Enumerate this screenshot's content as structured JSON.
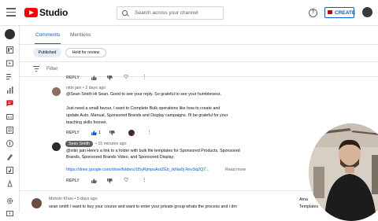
{
  "topbar": {
    "app_name": "Studio",
    "search_placeholder": "Search across your channel",
    "help_glyph": "?",
    "create_label": "CREATE"
  },
  "sidebar": {
    "icons": [
      "dashboard-icon",
      "content-icon",
      "playlists-icon",
      "analytics-icon",
      "comments-icon",
      "subtitles-icon",
      "copyright-icon",
      "earn-icon",
      "customization-icon",
      "audio-library-icon",
      "settings-icon",
      "feedback-icon"
    ],
    "active_index": 4
  },
  "tabs": {
    "comments_label": "Comments",
    "mentions_label": "Mentions"
  },
  "chips": {
    "published_label": "Published",
    "held_label": "Held for review"
  },
  "filter": {
    "label": "Filter"
  },
  "comments": {
    "top_reply": "REPLY",
    "c1": {
      "author": "nitin jain",
      "time": "2 days ago",
      "lines": [
        "@Sean Smith  Hi Sean, Good to see your reply. So grateful to see your humbleness.",
        "",
        "Just need a small favour, I want to Complete Bulk operations like how to create and",
        "update Auto, Manual, Sponsored Brands and Display campaigns. I'll be grateful for your",
        "teaching skills forever."
      ],
      "reply": "REPLY",
      "likes": "1"
    },
    "c2": {
      "author": "Sean Smith",
      "time": "15 minutes ago",
      "lines": [
        "@nitin jain  Here's a link to a folder with bulk file templates for Sponsored Products, Sponsored",
        "Brands, Sponsored Brands Video, and Sponsored Display:",
        "",
        "https://drive.google.com/drive/folders/1l5yRjmpoAotZEb_rkNw0j RevSq2Q7..."
      ],
      "read_more": "Read more",
      "reply": "REPLY"
    },
    "c3": {
      "author": "Mohsin Khan",
      "time": "5 days ago",
      "line": "sean smith I want to buy your course and want to enter your private group whats the process and i dm"
    }
  },
  "side_text": {
    "line1": "Ama",
    "line2": "Templates"
  },
  "colors": {
    "accent": "#065fd4",
    "brand": "#ff0000",
    "active_sidebar": "#cc0000"
  }
}
